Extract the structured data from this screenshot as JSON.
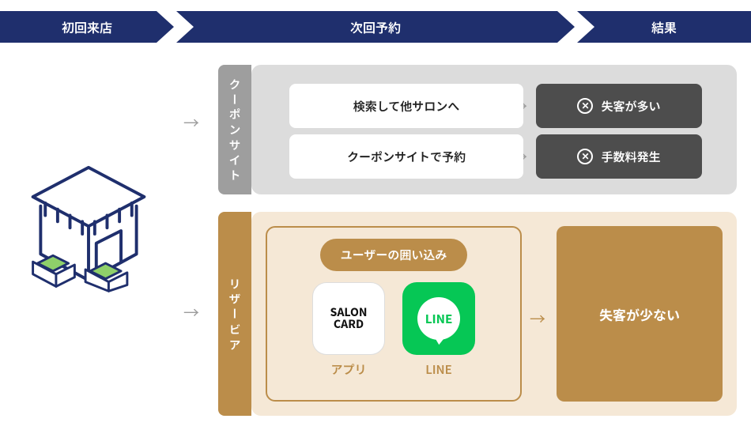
{
  "header": {
    "step1": "初回来店",
    "step2": "次回予約",
    "step3": "結果"
  },
  "tabs": {
    "coupon": "クーポンサイト",
    "reservia": "リザービア"
  },
  "coupon": {
    "row1_text": "検索して他サロンへ",
    "row1_result": "失客が多い",
    "row2_text": "クーポンサイトで予約",
    "row2_result": "手数料発生"
  },
  "reservia": {
    "pill": "ユーザーの囲い込み",
    "apps": {
      "salon": {
        "tile_line1": "SALON",
        "tile_line2": "CARD",
        "label": "アプリ"
      },
      "line": {
        "tile_text": "LINE",
        "label": "LINE"
      }
    },
    "result": "失客が少ない"
  },
  "icons": {
    "arrow_right": "→"
  }
}
